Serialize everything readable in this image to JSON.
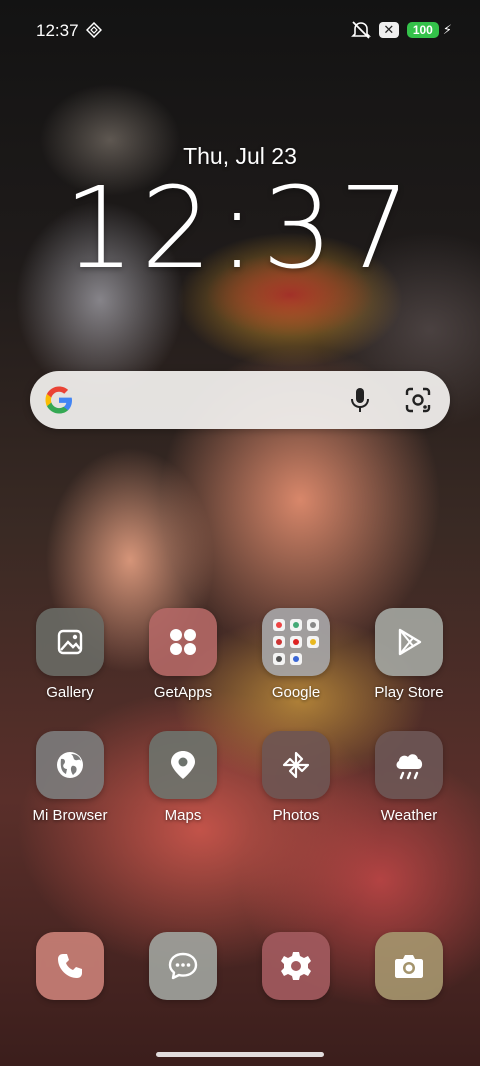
{
  "status_bar": {
    "time": "12:37",
    "battery_level": "100",
    "sync_icon": "diamond-sync-icon",
    "mute_icon": "bell-off-icon",
    "notification_badge": "✕",
    "charging_icon": "bolt-icon",
    "battery_color": "#34c24a"
  },
  "lockscreen": {
    "date": "Thu, Jul 23",
    "clock": "12:37"
  },
  "search_bar": {
    "logo": "google-g-icon",
    "mic": "mic-icon",
    "lens": "camera-lens-icon"
  },
  "apps": [
    {
      "label": "Gallery",
      "icon": "gallery-icon",
      "color": "#6a6c66"
    },
    {
      "label": "GetApps",
      "icon": "four-dots-icon",
      "color": "#b46866"
    },
    {
      "label": "Google",
      "icon": "folder-icon",
      "color": "#a6a6a8"
    },
    {
      "label": "Play Store",
      "icon": "play-store-icon",
      "color": "#a4a7a2"
    },
    {
      "label": "Mi Browser",
      "icon": "globe-icon",
      "color": "#7c7c7c"
    },
    {
      "label": "Maps",
      "icon": "map-pin-icon",
      "color": "#6d736d"
    },
    {
      "label": "Photos",
      "icon": "pinwheel-icon",
      "color": "#6e5553"
    },
    {
      "label": "Weather",
      "icon": "cloud-rain-icon",
      "color": "#6d5655"
    }
  ],
  "dock": [
    {
      "icon": "phone-icon",
      "color": "#c87f76"
    },
    {
      "icon": "messages-icon",
      "color": "#9ea29c"
    },
    {
      "icon": "settings-icon",
      "color": "#a25a5e"
    },
    {
      "icon": "camera-icon",
      "color": "#a4946c"
    }
  ]
}
